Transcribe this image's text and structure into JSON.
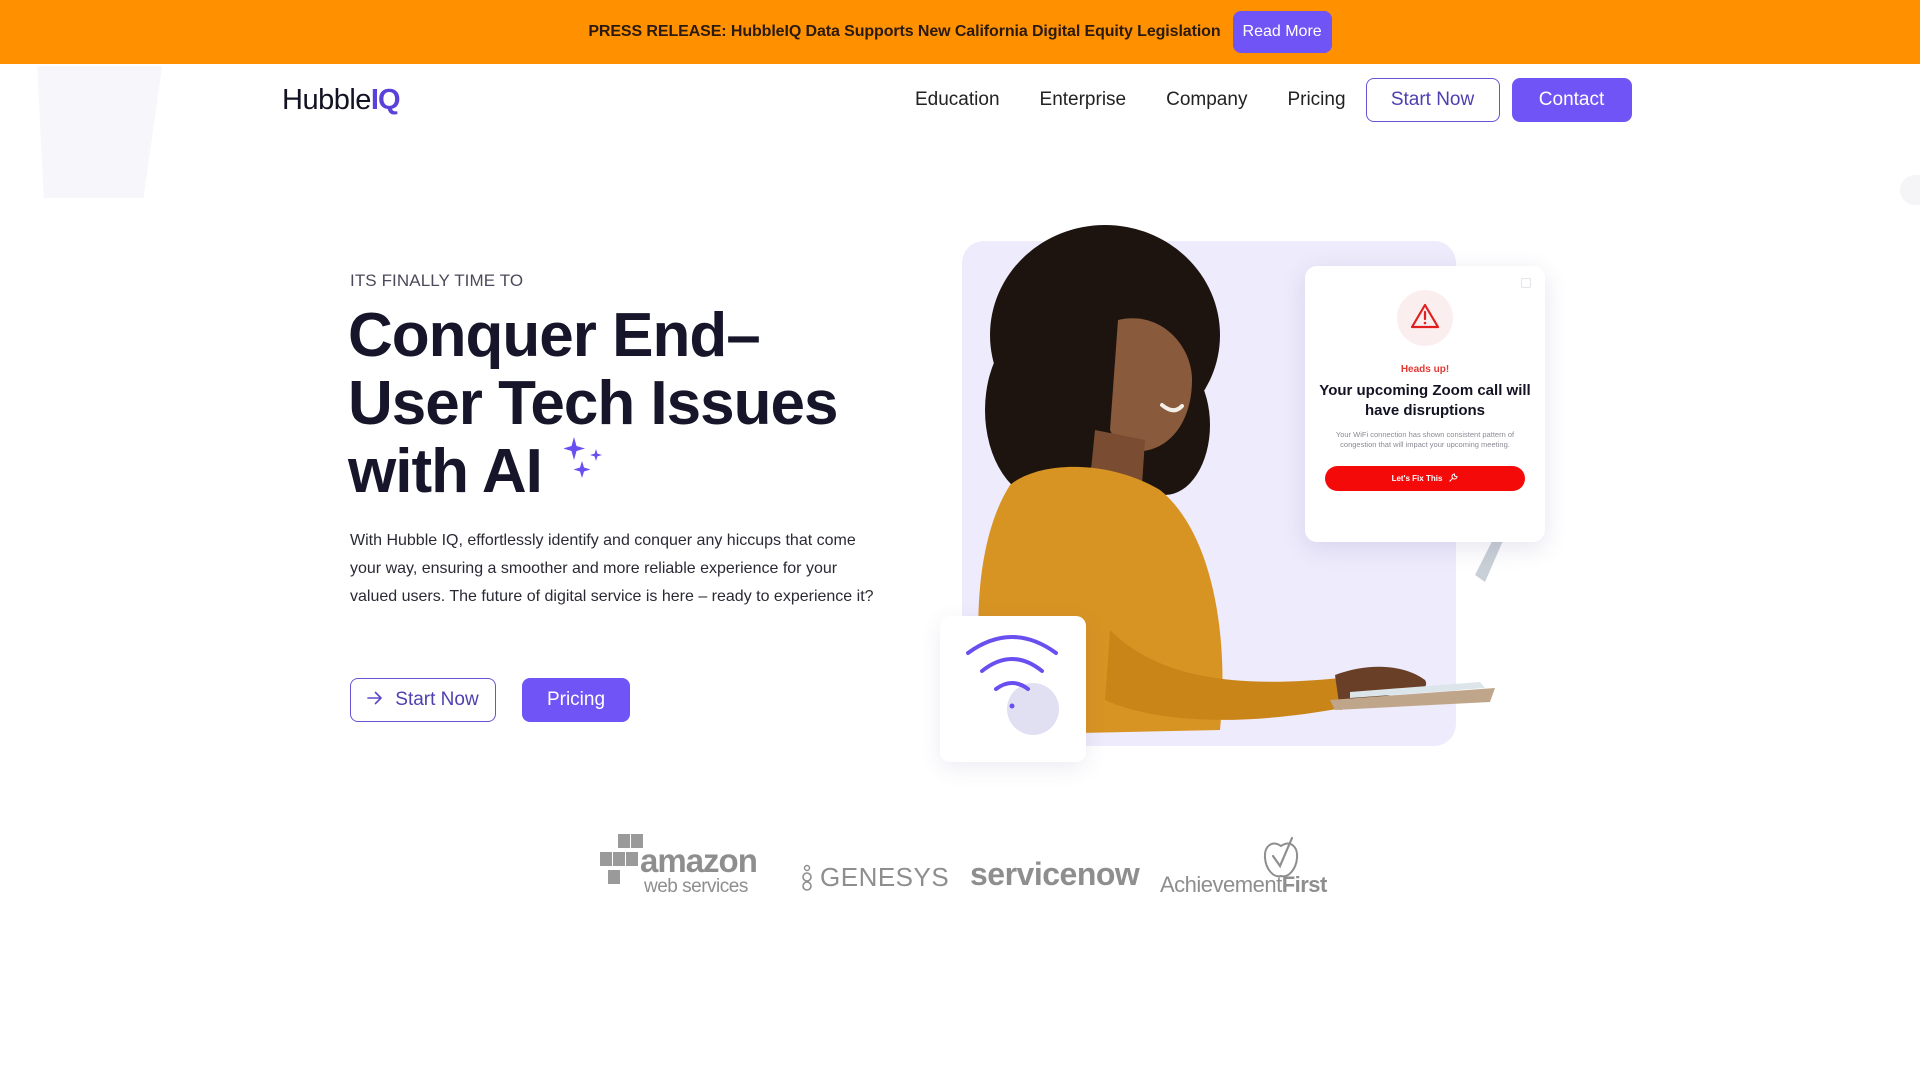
{
  "banner": {
    "text": "PRESS RELEASE: HubbleIQ Data Supports New California Digital Equity Legislation",
    "button_label": "Read More",
    "background_color": "#ff9000"
  },
  "header": {
    "logo_main": "Hubble",
    "logo_accent": "IQ",
    "nav": [
      {
        "label": "Education"
      },
      {
        "label": "Enterprise"
      },
      {
        "label": "Company"
      },
      {
        "label": "Pricing"
      }
    ],
    "start_label": "Start Now",
    "contact_label": "Contact"
  },
  "hero": {
    "eyebrow": "ITS FINALLY TIME TO",
    "title_line1": "Conquer End–",
    "title_line2": "User Tech Issues",
    "title_line3": "with AI",
    "sparkle_icon": "sparkles-icon",
    "description": "With Hubble IQ, effortlessly identify and conquer any hiccups that come your way, ensuring a smoother and more reliable experience for your valued users. The future of digital service is here – ready to experience it?",
    "start_label": "Start Now",
    "start_icon": "arrow-right-icon",
    "pricing_label": "Pricing",
    "accent_color": "#7054f5"
  },
  "alert_card": {
    "icon": "warning-triangle-icon",
    "eyebrow": "Heads up!",
    "title": "Your upcoming Zoom call will have disruptions",
    "body": "Your WiFi connection has shown consistent pattern of congestion that will impact your upcoming meeting.",
    "button_label": "Let's Fix This",
    "button_icon": "wrench-icon",
    "button_color": "#f50a0a"
  },
  "wifi_card": {
    "icon": "wifi-icon"
  },
  "logos": {
    "aws_word": "amazon",
    "aws_sub": "web services",
    "genesys": "GENESYS",
    "servicenow": "servicenow",
    "achievement_regular": "Achievement",
    "achievement_bold": "First"
  }
}
